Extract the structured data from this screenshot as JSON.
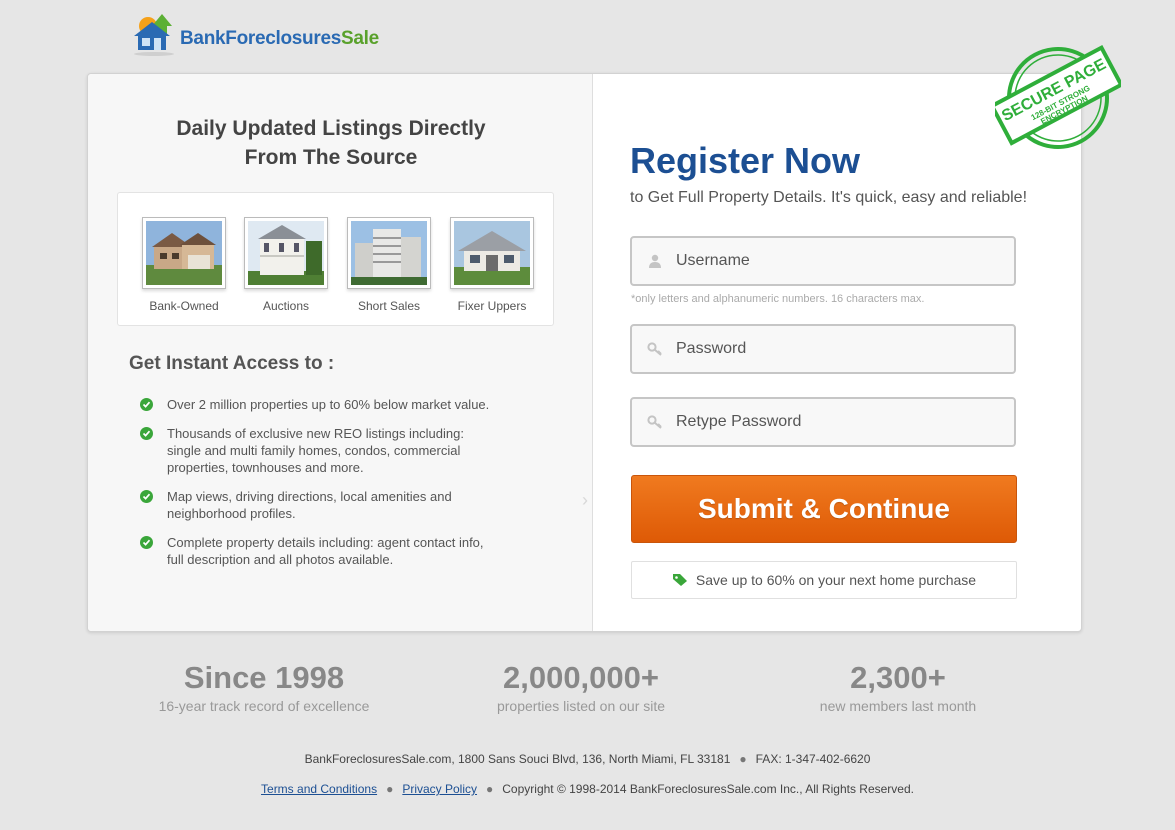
{
  "brand": {
    "part1": "Bank",
    "part2": "Foreclosures",
    "part3": "Sale"
  },
  "left": {
    "title_line1": "Daily Updated Listings Directly",
    "title_line2": "From The Source",
    "property_types": [
      {
        "label": "Bank-Owned"
      },
      {
        "label": "Auctions"
      },
      {
        "label": "Short Sales"
      },
      {
        "label": "Fixer Uppers"
      }
    ],
    "access_title": "Get Instant Access to :",
    "benefits": [
      {
        "text": "Over 2 million properties up to 60% below market value."
      },
      {
        "text": "Thousands of exclusive new REO listings including:\n single and multi family homes, condos, commercial\n properties, townhouses and more."
      },
      {
        "text": "Map views, driving directions, local amenities and\nneighborhood profiles."
      },
      {
        "text": "Complete property details including: agent contact info,\nfull description and all photos available."
      }
    ]
  },
  "form": {
    "title": "Register Now",
    "subtitle": "to Get Full Property Details. It's quick, easy and reliable!",
    "username_placeholder": "Username",
    "username_hint": "*only letters and alphanumeric numbers. 16 characters max.",
    "password_placeholder": "Password",
    "retype_placeholder": "Retype Password",
    "submit_label": "Submit & Continue",
    "save_note": "Save up to 60% on your next home purchase"
  },
  "stamp": {
    "line1": "SECURE PAGE",
    "line2": "128-BIT STRONG",
    "line3": "ENCRYPTION"
  },
  "stats": [
    {
      "value": "Since 1998",
      "label": "16-year track record of excellence"
    },
    {
      "value": "2,000,000+",
      "label": "properties listed on our site"
    },
    {
      "value": "2,300+",
      "label": "new members last month"
    }
  ],
  "footer": {
    "address": "BankForeclosuresSale.com, 1800 Sans Souci Blvd, 136, North Miami, FL 33181",
    "fax": "FAX: 1-347-402-6620",
    "terms": "Terms and Conditions",
    "privacy": "Privacy Policy",
    "copyright": "Copyright © 1998-2014 BankForeclosuresSale.com Inc., All Rights Reserved."
  },
  "colors": {
    "accent_blue": "#1c4f93",
    "cta_orange": "#e8670f",
    "check_green": "#3aa63a",
    "stamp_green": "#2fae3a"
  }
}
